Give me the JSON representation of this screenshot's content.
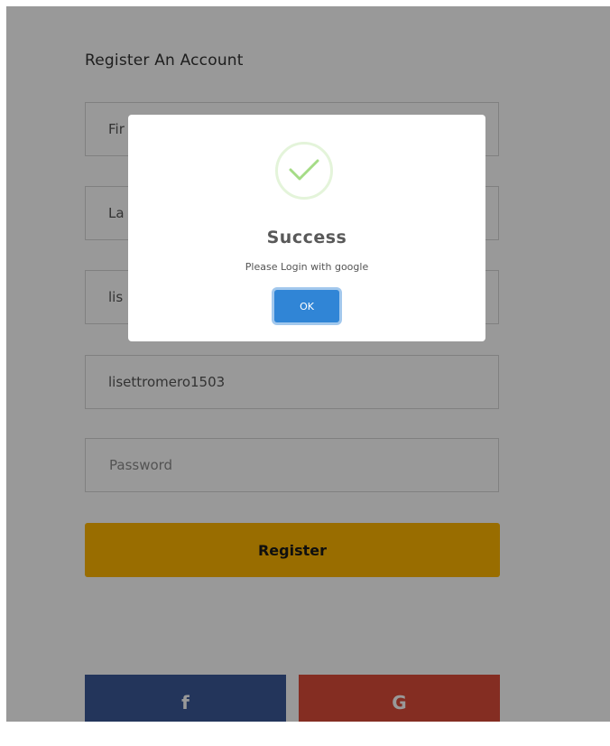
{
  "form": {
    "title": "Register An Account",
    "first_name_prefix": "Fir",
    "last_name_prefix": "La",
    "email_prefix": "lis",
    "username_value": "lisettromero1503",
    "password_placeholder": "Password",
    "register_label": "Register"
  },
  "social": {
    "facebook_label": "f",
    "google_label": "G"
  },
  "modal": {
    "title": "Success",
    "message": "Please Login with google",
    "ok_label": "OK"
  },
  "colors": {
    "register": "#ffb600",
    "facebook": "#3b5998",
    "google": "#dd4b39",
    "ok": "#3085d6",
    "success": "#a5dc86"
  }
}
